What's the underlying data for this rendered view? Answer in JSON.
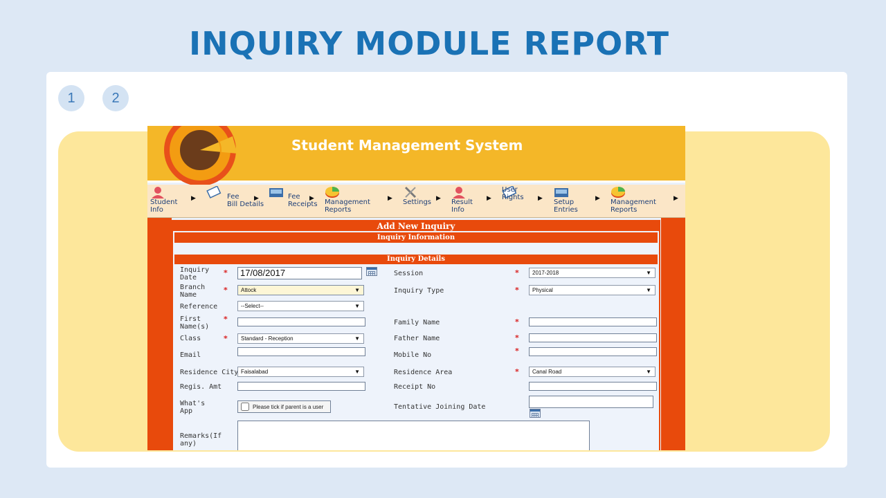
{
  "slide": {
    "title": "INQUIRY MODULE REPORT",
    "pages": [
      "1",
      "2"
    ]
  },
  "app": {
    "title": "Student Management System",
    "menu": [
      {
        "label": "Student\nInfo",
        "icon": "student-icon"
      },
      {
        "label": "Fee\nBill Details",
        "icon": "bill-icon"
      },
      {
        "label": "Fee\nReceipts",
        "icon": "receipt-icon"
      },
      {
        "label": "Management\nReports",
        "icon": "pie-chart-icon"
      },
      {
        "label": "Settings",
        "icon": "tools-icon"
      },
      {
        "label": "Result\nInfo",
        "icon": "student-icon"
      },
      {
        "label": "User\nRights",
        "icon": "bill-icon"
      },
      {
        "label": "Setup\nEntries",
        "icon": "receipt-icon"
      },
      {
        "label": "Management\nReports",
        "icon": "pie-chart-icon"
      }
    ],
    "form": {
      "header": "Add New Inquiry",
      "section1": "Inquiry Information",
      "section2": "Inquiry Details",
      "fields": {
        "inquiry_date": {
          "label": "Inquiry\nDate",
          "value": "17/08/2017"
        },
        "session": {
          "label": "Session",
          "value": "2017-2018"
        },
        "branch": {
          "label": "Branch\nName",
          "value": "Attock"
        },
        "inquiry_type": {
          "label": "Inquiry Type",
          "value": "Physical"
        },
        "reference": {
          "label": "Reference",
          "value": "--Select--"
        },
        "first_name": {
          "label": "First\nName(s)",
          "value": ""
        },
        "family_name": {
          "label": "Family Name",
          "value": ""
        },
        "class": {
          "label": "Class",
          "value": "Standard - Reception"
        },
        "father_name": {
          "label": "Father Name",
          "value": ""
        },
        "email": {
          "label": "Email",
          "value": ""
        },
        "mobile": {
          "label": "Mobile No",
          "value": ""
        },
        "city": {
          "label": "Residence City",
          "value": "Faisalabad"
        },
        "area": {
          "label": "Residence Area",
          "value": "Canal Road"
        },
        "regis_amt": {
          "label": "Regis. Amt",
          "value": ""
        },
        "receipt_no": {
          "label": "Receipt No",
          "value": ""
        },
        "whatsapp": {
          "label": "What's\nApp",
          "checkbox_label": "Please tick if parent is a user",
          "checked": false
        },
        "joining_date": {
          "label": "Tentative Joining Date",
          "value": ""
        },
        "remarks": {
          "label": "Remarks(If\nany)",
          "value": ""
        }
      }
    }
  },
  "colors": {
    "title_blue": "#1a72b5",
    "header_yellow": "#f4b728",
    "form_orange": "#e84a0c",
    "panel_yellow": "#fde79b"
  }
}
